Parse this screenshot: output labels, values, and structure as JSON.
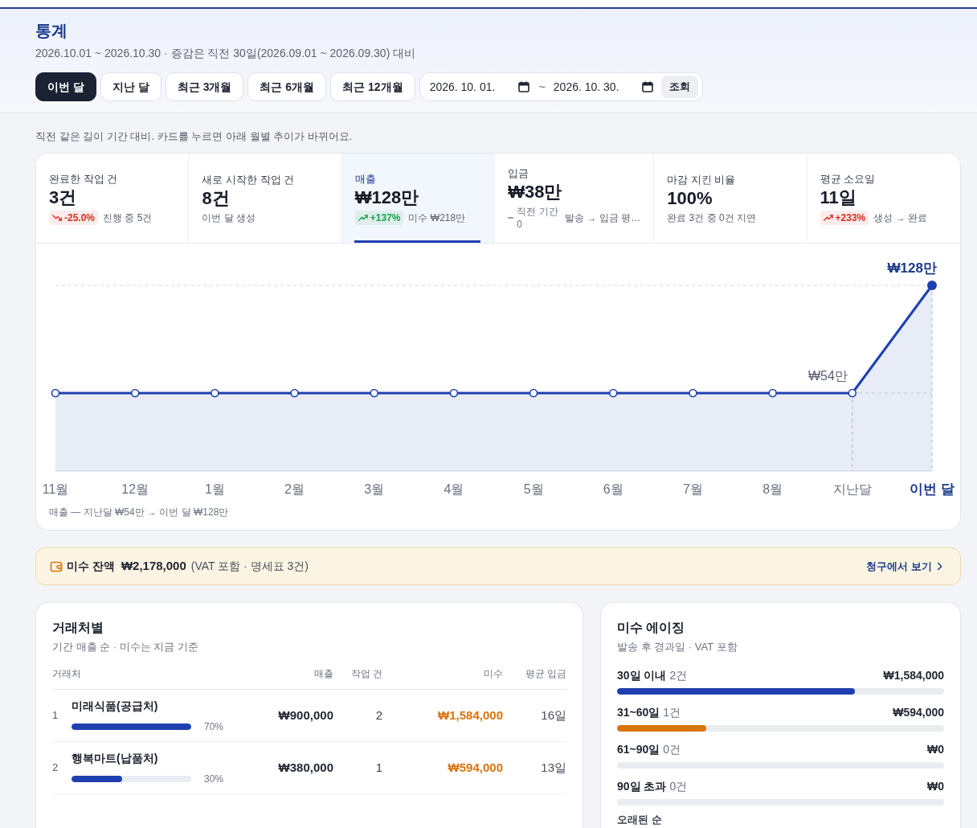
{
  "page": {
    "title": "통계",
    "subtitle": "2026.10.01 ~ 2026.10.30 · 증감은 직전 30일(2026.09.01 ~ 2026.09.30) 대비"
  },
  "filters": {
    "periods": [
      {
        "label": "이번 달",
        "selected": true
      },
      {
        "label": "지난 달",
        "selected": false
      },
      {
        "label": "최근 3개월",
        "selected": false
      },
      {
        "label": "최근 6개월",
        "selected": false
      },
      {
        "label": "최근 12개월",
        "selected": false
      }
    ],
    "date_from": {
      "value": "2026. 10. 01."
    },
    "separator": "~",
    "date_to": {
      "value": "2026. 10. 30."
    },
    "apply_button": "조회"
  },
  "hint": "직전 같은 길이 기간 대비. 카드를 누르면 아래 월별 추이가 바뀌어요.",
  "kpis": [
    {
      "label": "완료한 작업 건",
      "value": "3건",
      "selected": false,
      "delta": {
        "kind": "down",
        "color": "#d92d20",
        "text": "-25.0%"
      },
      "note": "진행 중 5건"
    },
    {
      "label": "새로 시작한 작업 건",
      "value": "8건",
      "selected": false,
      "note": "이번 달 생성"
    },
    {
      "label": "매출",
      "value": "₩128만",
      "selected": true,
      "delta": {
        "kind": "up",
        "color": "#16a34a",
        "text": "+137%"
      },
      "note": "미수 ₩218만"
    },
    {
      "label": "입금",
      "value": "₩38만",
      "selected": false,
      "delta": {
        "kind": "flat",
        "text": "직전 기간 0"
      },
      "note": "발송 → 입금 평…"
    },
    {
      "label": "마감 지킨 비율",
      "value": "100%",
      "selected": false,
      "note": "완료 3건 중 0건 지연"
    },
    {
      "label": "평균 소요일",
      "value": "11일",
      "selected": false,
      "delta": {
        "kind": "up",
        "color": "#d92d20",
        "text": "+233%"
      },
      "note": "생성 → 완료"
    }
  ],
  "trend": {
    "months": [
      "11월",
      "12월",
      "1월",
      "2월",
      "3월",
      "4월",
      "5월",
      "6월",
      "7월",
      "8월",
      "지난달",
      "이번 달"
    ],
    "value_labels": [
      "₩54만",
      "₩128만"
    ],
    "caption": "매출 — 지난달 ₩54만 → 이번 달 ₩128만"
  },
  "receivable_alert": {
    "label": "미수 잔액",
    "amount": "₩2,178,000",
    "detail": "(VAT 포함 · 명세표 3건)",
    "link": "청구에서 보기"
  },
  "clients": {
    "title": "거래처별",
    "subtitle": "기간 매출 순 · 미수는 지금 기준",
    "columns": [
      "거래처",
      "매출",
      "작업 건",
      "미수",
      "평균 입금"
    ],
    "rows": [
      {
        "rank": "1",
        "name": "미래식품(공급처)",
        "level": 1,
        "share": "70%",
        "sales": "₩900,000",
        "jobs": "2",
        "unpaid": "₩1,584,000",
        "avg_payment": "16일"
      },
      {
        "rank": "2",
        "name": "행복마트(납품처)",
        "level": 0.42,
        "share": "30%",
        "sales": "₩380,000",
        "jobs": "1",
        "unpaid": "₩594,000",
        "avg_payment": "13일"
      }
    ]
  },
  "aging": {
    "title": "미수 에이징",
    "subtitle": "발송 후 경과일 · VAT 포함",
    "rows": [
      {
        "label": "30일 이내",
        "count": "2건",
        "amount": "₩1,584,000",
        "level": 0.727,
        "color": "#1e40af"
      },
      {
        "label": "31~60일",
        "count": "1건",
        "amount": "₩594,000",
        "level": 0.273,
        "color": "#d9730d"
      },
      {
        "label": "61~90일",
        "count": "0건",
        "amount": "₩0"
      },
      {
        "label": "90일 초과",
        "count": "0건",
        "amount": "₩0"
      }
    ],
    "section_title": "오래된 순"
  }
}
